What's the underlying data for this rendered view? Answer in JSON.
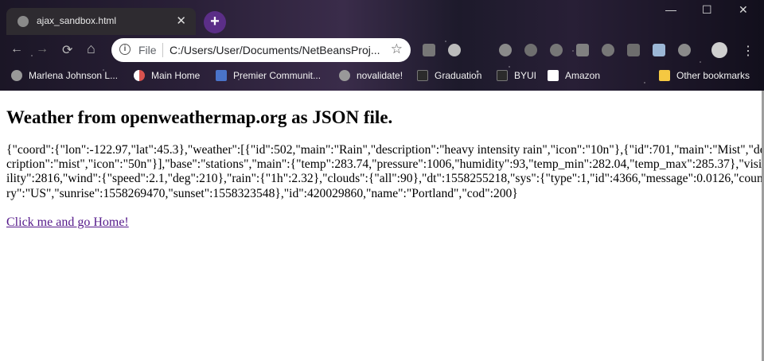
{
  "browser": {
    "tab": {
      "title": "ajax_sandbox.html",
      "close": "✕"
    },
    "new_tab": "+",
    "window_controls": {
      "minimize": "—",
      "maximize": "☐",
      "close": "✕"
    },
    "nav": {
      "back": "←",
      "forward": "→",
      "reload": "⟳",
      "home": "⌂"
    },
    "omnibox": {
      "scheme": "File",
      "url": "C:/Users/User/Documents/NetBeansProj..."
    },
    "bookmarks": [
      {
        "label": "Marlena Johnson L...",
        "icon": "globe-icon"
      },
      {
        "label": "Main Home",
        "icon": "page-icon"
      },
      {
        "label": "Premier Communit...",
        "icon": "page-icon"
      },
      {
        "label": "novalidate!",
        "icon": "globe-icon"
      },
      {
        "label": "Graduation",
        "icon": "byu-icon"
      },
      {
        "label": "BYUI",
        "icon": "byu-icon"
      },
      {
        "label": "Amazon",
        "icon": "amazon-icon"
      },
      {
        "label": "Other bookmarks",
        "icon": "folder-icon"
      }
    ],
    "accent": "#5b2e87"
  },
  "page": {
    "heading": "Weather from openweathermap.org as JSON file.",
    "json_text": "{\"coord\":{\"lon\":-122.97,\"lat\":45.3},\"weather\":[{\"id\":502,\"main\":\"Rain\",\"description\":\"heavy intensity rain\",\"icon\":\"10n\"},{\"id\":701,\"main\":\"Mist\",\"description\":\"mist\",\"icon\":\"50n\"}],\"base\":\"stations\",\"main\":{\"temp\":283.74,\"pressure\":1006,\"humidity\":93,\"temp_min\":282.04,\"temp_max\":285.37},\"visibility\":2816,\"wind\":{\"speed\":2.1,\"deg\":210},\"rain\":{\"1h\":2.32},\"clouds\":{\"all\":90},\"dt\":1558255218,\"sys\":{\"type\":1,\"id\":4366,\"message\":0.0126,\"country\":\"US\",\"sunrise\":1558269470,\"sunset\":1558323548},\"id\":420029860,\"name\":\"Portland\",\"cod\":200}",
    "link_text": "Click me and go Home!"
  }
}
